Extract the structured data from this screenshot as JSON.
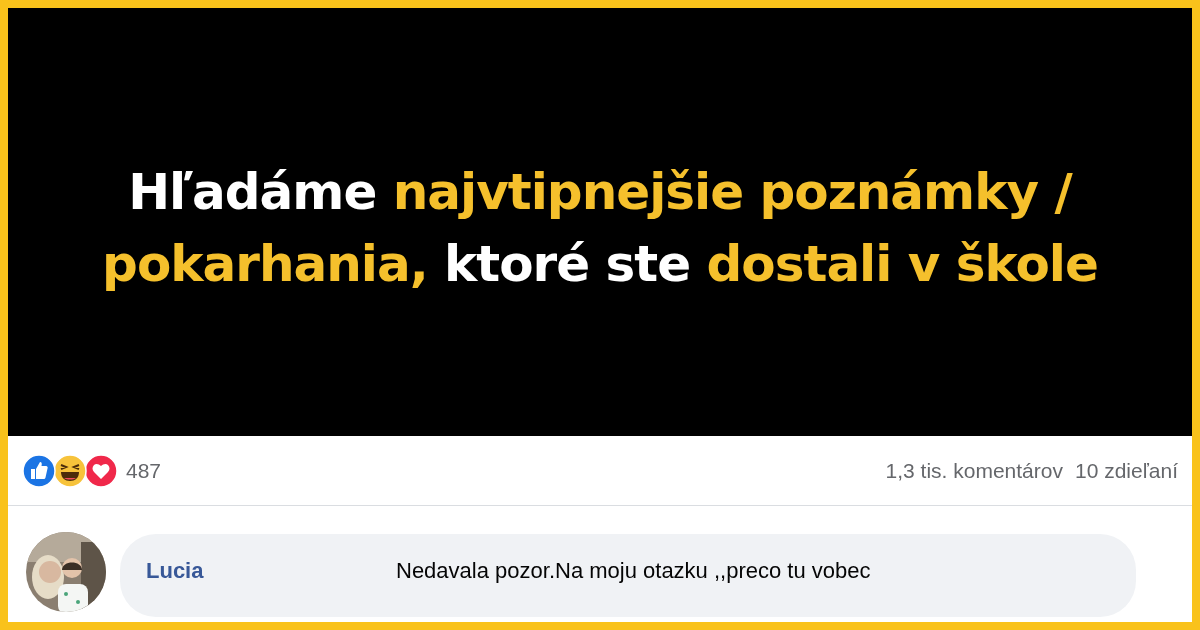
{
  "banner": {
    "lines": [
      [
        {
          "text": "Hľadáme ",
          "highlight": false
        },
        {
          "text": "najvtipnejšie poznámky /",
          "highlight": true
        }
      ],
      [
        {
          "text": "pokarhania,",
          "highlight": true
        },
        {
          "text": " ktoré ste ",
          "highlight": false
        },
        {
          "text": "dostali v škole",
          "highlight": true
        }
      ]
    ]
  },
  "reactions": {
    "count": "487",
    "comments": "1,3 tis. komentárov",
    "shares": "10 zdieľaní"
  },
  "comment": {
    "author": "Lucia",
    "text": "Nedavala pozor.Na moju otazku ,,preco tu vobec"
  }
}
